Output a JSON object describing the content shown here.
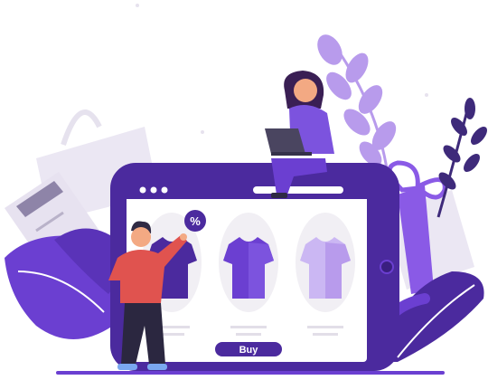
{
  "shop": {
    "buy_label": "Buy",
    "discount_symbol": "%"
  },
  "colors": {
    "purple_dark": "#4b2a9e",
    "purple_mid": "#6b3fd1",
    "purple_light": "#a07fe6",
    "purple_pale": "#cbb7f3",
    "lavender_bg": "#ebe7f3",
    "shirt_red": "#e0534f",
    "skin": "#f3a983"
  },
  "icons": [
    "shopping-bag-icon",
    "credit-card-icon",
    "gift-box-icon",
    "laptop-icon",
    "tshirt-icon",
    "percent-badge-icon"
  ]
}
